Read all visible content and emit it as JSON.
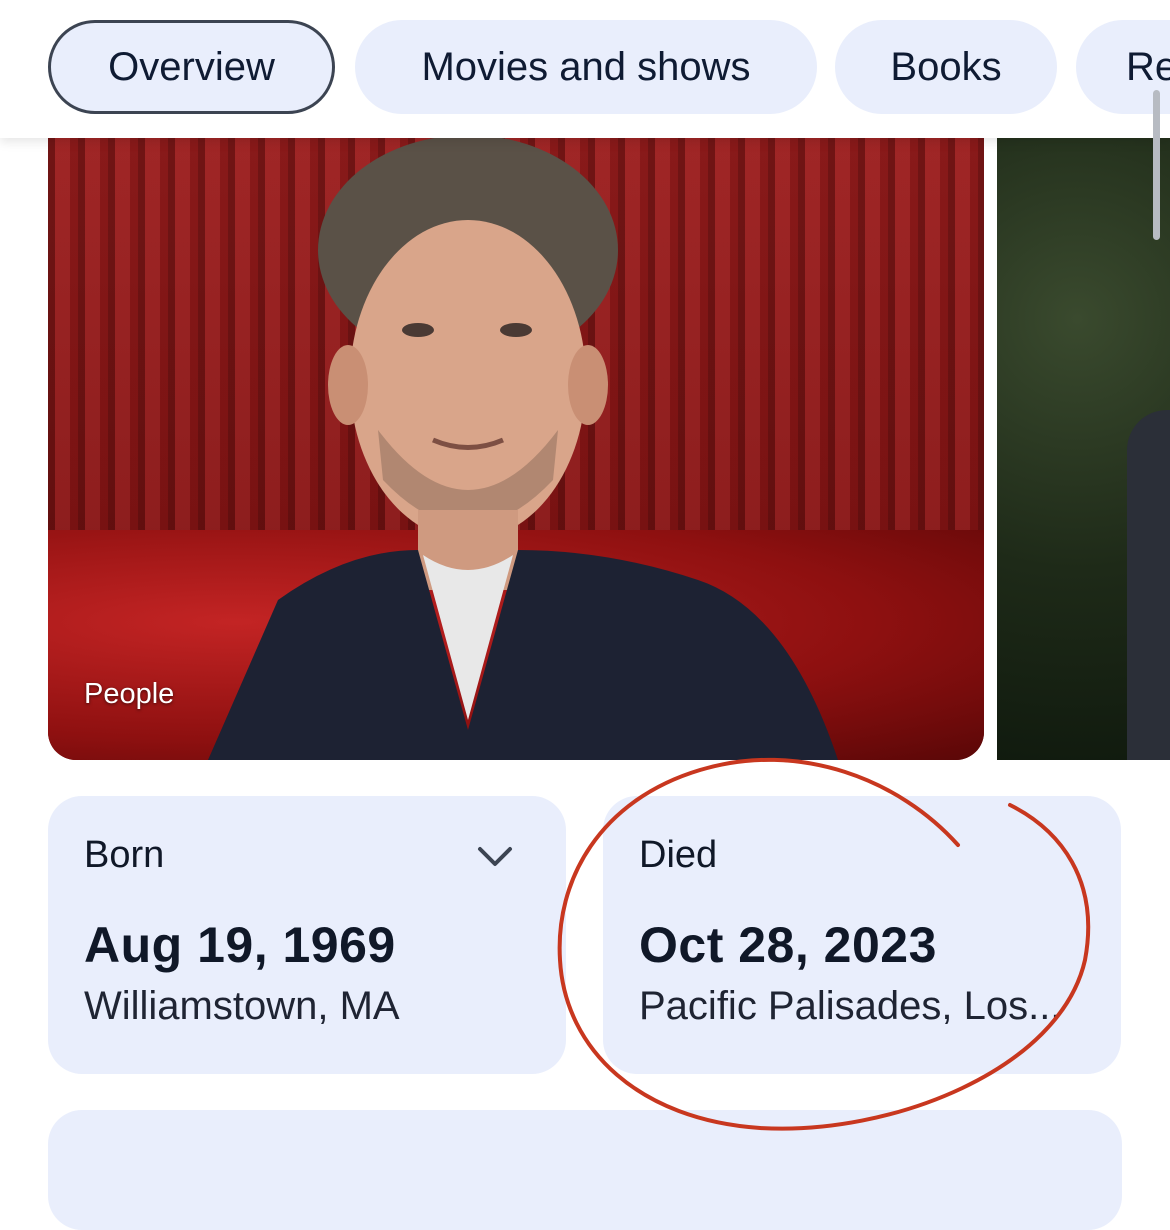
{
  "tabs": [
    {
      "label": "Overview",
      "selected": true
    },
    {
      "label": "Movies and shows",
      "selected": false
    },
    {
      "label": "Books",
      "selected": false
    },
    {
      "label": "Re",
      "selected": false
    }
  ],
  "images": {
    "main_caption": "People"
  },
  "facts": {
    "born": {
      "label": "Born",
      "date": "Aug 19, 1969",
      "place": "Williamstown, MA",
      "expand_icon": "chevron-down-icon"
    },
    "died": {
      "label": "Died",
      "date": "Oct 28, 2023",
      "place": "Pacific Palisades, Los..."
    }
  },
  "annotation": {
    "shape": "hand-drawn circle",
    "color": "#c8371f"
  },
  "colors": {
    "chip_bg": "#e9eefc",
    "card_bg": "#e9eefc",
    "text_dark": "#101828"
  }
}
